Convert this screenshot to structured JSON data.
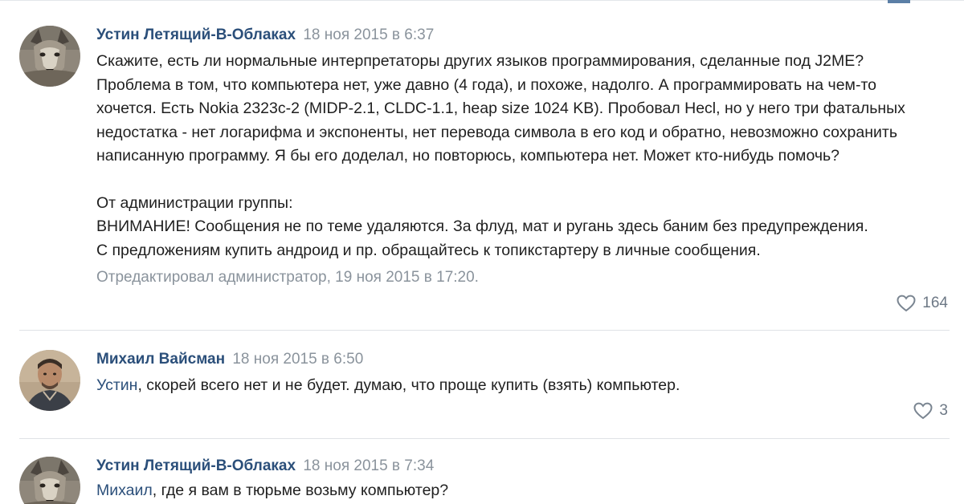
{
  "comments": [
    {
      "author": "Устин Летящий-В-Облаках",
      "date": "18 ноя 2015 в 6:37",
      "text_lines": [
        "Скажите, есть ли нормальные интерпретаторы других языков программирования, сделанные под J2ME?",
        "Проблема в том, что компьютера нет, уже давно (4 года), и похоже, надолго. А программировать на чем-то",
        "хочется. Есть Nokia 2323c-2 (MIDP-2.1, CLDC-1.1, heap size 1024 KB). Пробовал Hecl, но у него три фатальных",
        "недостатка - нет логарифма и экспоненты, нет перевода символа в его код и обратно, невозможно сохранить",
        "написанную программу. Я бы его доделал, но повторюсь, компьютера нет. Может кто-нибудь помочь?"
      ],
      "admin_lines": [
        "От администрации группы:",
        "ВНИМАНИЕ! Сообщения не по теме удаляются. За флуд, мат и ругань здесь баним без предупреждения.",
        "С предложениям купить андроид и пр. обращайтесь к топикстартеру в личные сообщения."
      ],
      "edited": "Отредактировал администратор, 19 ноя 2015 в 17:20.",
      "likes": "164",
      "avatar_icon": "wolf-avatar"
    },
    {
      "author": "Михаил Вайсман",
      "date": "18 ноя 2015 в 6:50",
      "mention": "Устин",
      "text": ", скорей всего нет и не будет. думаю, что проще купить (взять) компьютер.",
      "likes": "3",
      "avatar_icon": "man-avatar"
    },
    {
      "author": "Устин Летящий-В-Облаках",
      "date": "18 ноя 2015 в 7:34",
      "mention": "Михаил",
      "text": ", где я вам в тюрьме возьму компьютер?",
      "avatar_icon": "wolf-avatar"
    }
  ],
  "colors": {
    "author": "#2b4f7a",
    "meta": "#8a939c",
    "text": "#1f1f1f",
    "divider": "#dfe2e6"
  },
  "icons": {
    "like": "heart-outline-icon"
  }
}
